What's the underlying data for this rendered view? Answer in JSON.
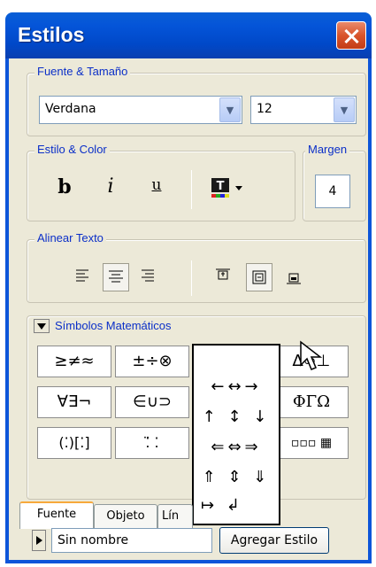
{
  "window": {
    "title": "Estilos"
  },
  "font_group": {
    "label": "Fuente & Tamaño",
    "font_value": "Verdana",
    "size_value": "12"
  },
  "style_group": {
    "label": "Estilo & Color",
    "bold": "b",
    "italic": "i",
    "underline": "u"
  },
  "margin_group": {
    "label": "Margen",
    "value": "4"
  },
  "align_group": {
    "label": "Alinear Texto"
  },
  "symbols_group": {
    "label": "Símbolos Matemáticos",
    "buttons": [
      "≥≠≈",
      "±÷⊗",
      "→↕⇐",
      "∆∞⊥",
      "∀∃¬",
      "∈∪⊃",
      "ΦΓΩ",
      "(⁚)[⁚]",
      "⁚̈ ⁚",
      "▫▫▫ ▦"
    ]
  },
  "palette": {
    "rows": [
      "←↔→",
      "↑ ↕ ↓",
      "⇐⇔⇒",
      "⇑ ⇕ ⇓",
      "↦ ↲"
    ]
  },
  "tabs": [
    "Fuente",
    "Objeto",
    "Lín"
  ],
  "bottom": {
    "style_name": "Sin nombre",
    "add_button": "Agregar Estilo"
  }
}
